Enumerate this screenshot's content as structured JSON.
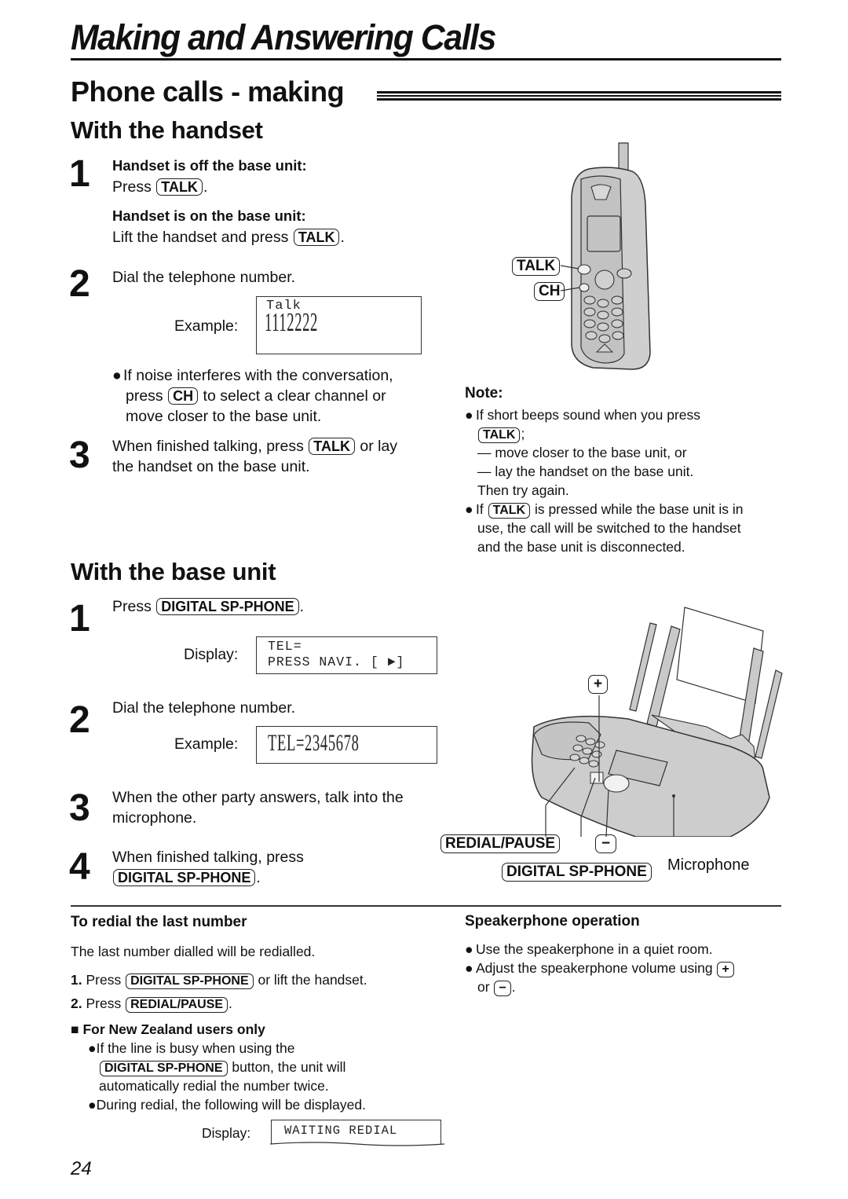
{
  "header": {
    "chapter_title": "Making and Answering Calls",
    "section_title": "Phone calls - making"
  },
  "handset": {
    "title": "With the handset",
    "steps": [
      {
        "number": "1",
        "off_heading": "Handset is off the base unit:",
        "off_text": "Press",
        "off_key": "TALK",
        "on_heading": "Handset is on the base unit:",
        "on_text": "Lift the handset and press",
        "on_key": "TALK"
      },
      {
        "number": "2",
        "text": "Dial the telephone number.",
        "example_label": "Example:",
        "display_line1": "Talk",
        "display_line2": "1112222",
        "bullet_pre": "If noise interferes with the conversation,",
        "bullet_press": "press",
        "bullet_key": "CH",
        "bullet_post": "to select a clear channel or",
        "bullet_line3": "move closer to the base unit."
      },
      {
        "number": "3",
        "text_pre": "When finished talking, press",
        "key": "TALK",
        "text_post": "or lay",
        "text_line2": "the handset on the base unit."
      }
    ],
    "illustration": {
      "talk_label": "TALK",
      "ch_label": "CH"
    },
    "note": {
      "heading": "Note:",
      "item1_line1": "If short beeps sound when you press",
      "item1_key": "TALK",
      "item1_dash1": "— move closer to the base unit, or",
      "item1_dash2": "— lay the handset on the base unit.",
      "item1_then": "Then try again.",
      "item2_pre": "If",
      "item2_key": "TALK",
      "item2_post": "is pressed while the base unit is in",
      "item2_line2": "use, the call will be switched to the handset",
      "item2_line3": "and the base unit is disconnected."
    }
  },
  "base_unit": {
    "title": "With the base unit",
    "steps": [
      {
        "number": "1",
        "text": "Press",
        "key": "DIGITAL SP-PHONE",
        "display_label": "Display:",
        "display_line1": "TEL=",
        "display_line2": "PRESS NAVI. [ ►]"
      },
      {
        "number": "2",
        "text": "Dial the telephone number.",
        "example_label": "Example:",
        "display": "TEL=2345678"
      },
      {
        "number": "3",
        "text_line1": "When the other party answers, talk into the",
        "text_line2": "microphone."
      },
      {
        "number": "4",
        "text": "When finished talking, press",
        "key": "DIGITAL SP-PHONE"
      }
    ],
    "illustration": {
      "plus_label": "+",
      "minus_label": "−",
      "redial_label": "REDIAL/PAUSE",
      "digital_label": "DIGITAL SP-PHONE",
      "microphone_label": "Microphone"
    }
  },
  "redial": {
    "title": "To redial the last number",
    "intro": "The last number dialled will be redialled.",
    "steps": [
      {
        "num": "1.",
        "pre": "Press",
        "key": "DIGITAL SP-PHONE",
        "post": "or lift the handset."
      },
      {
        "num": "2.",
        "pre": "Press",
        "key": "REDIAL/PAUSE",
        "post": "."
      }
    ],
    "nz": {
      "heading": "For New Zealand users only",
      "bullet1_line1": "If the line is busy when using the",
      "bullet1_key": "DIGITAL SP-PHONE",
      "bullet1_post": "button, the unit will",
      "bullet1_line3": "automatically redial the number twice.",
      "bullet2": "During redial, the following will be displayed.",
      "display_label": "Display:",
      "display": "WAITING REDIAL"
    }
  },
  "speakerphone": {
    "title": "Speakerphone operation",
    "bullet1": "Use the speakerphone in a quiet room.",
    "bullet2_pre": "Adjust the speakerphone volume using",
    "plus_key": "+",
    "bullet2_or": "or",
    "minus_key": "−"
  },
  "footer": {
    "page_number": "24"
  }
}
